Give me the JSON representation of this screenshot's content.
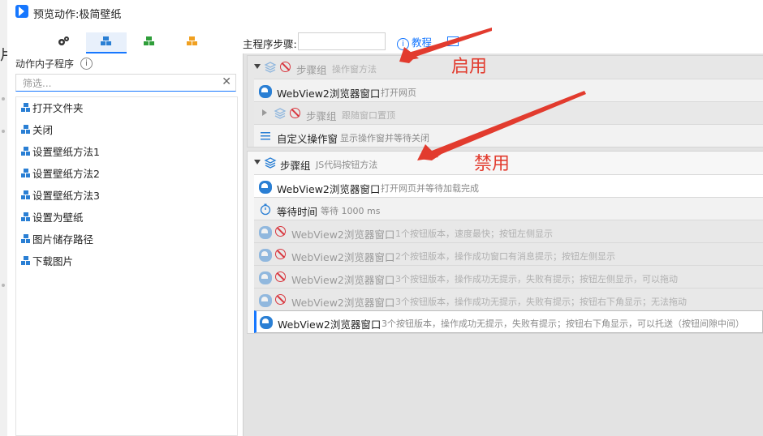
{
  "window": {
    "title": "预览动作:极简壁纸"
  },
  "underlay": {
    "glyph": "片"
  },
  "left_panel": {
    "tabs": [
      {
        "icon": "gears-icon",
        "active": false
      },
      {
        "icon": "blue-stack-icon",
        "active": true
      },
      {
        "icon": "green-stack-icon",
        "active": false
      },
      {
        "icon": "orange-stack-icon",
        "active": false
      }
    ],
    "title": "动作内子程序",
    "info": "i",
    "filter": {
      "placeholder": "筛选...",
      "value": "",
      "clear": "✕"
    },
    "items": [
      {
        "label": "打开文件夹"
      },
      {
        "label": "关闭"
      },
      {
        "label": "设置壁纸方法1"
      },
      {
        "label": "设置壁纸方法2"
      },
      {
        "label": "设置壁纸方法3"
      },
      {
        "label": "设置为壁纸"
      },
      {
        "label": "图片储存路径"
      },
      {
        "label": "下载图片"
      }
    ]
  },
  "right_panel": {
    "main_steps_label": "主程序步骤:",
    "main_steps_value": "",
    "tutorial": "教程",
    "group1": {
      "header": {
        "name": "步骤组",
        "desc": "操作窗方法",
        "enabled": false
      },
      "children": [
        {
          "name": "WebView2浏览器窗口",
          "desc": "打开网页",
          "enabled": true,
          "icon": "edge-icon"
        },
        {
          "name": "步骤组",
          "desc": "跟随窗口置顶",
          "enabled": false,
          "icon": "stack-icon"
        },
        {
          "name": "自定义操作窗",
          "desc": "显示操作窗并等待关闭",
          "enabled": true,
          "icon": "menu-icon"
        }
      ]
    },
    "group2": {
      "header": {
        "name": "步骤组",
        "desc": "JS代码按钮方法",
        "enabled": true
      },
      "children": [
        {
          "name": "WebView2浏览器窗口",
          "desc": "打开网页并等待加载完成",
          "enabled": true,
          "icon": "edge-icon"
        },
        {
          "name": "等待时间",
          "desc": "等待 1000 ms",
          "enabled": true,
          "icon": "timer-icon"
        },
        {
          "name": "WebView2浏览器窗口",
          "desc": "1个按钮版本，速度最快；按钮左侧显示",
          "enabled": false,
          "icon": "edge-icon"
        },
        {
          "name": "WebView2浏览器窗口",
          "desc": "2个按钮版本，操作成功窗口有消息提示；按钮左侧显示",
          "enabled": false,
          "icon": "edge-icon"
        },
        {
          "name": "WebView2浏览器窗口",
          "desc": "3个按钮版本，操作成功无提示，失败有提示；按钮左侧显示，可以拖动",
          "enabled": false,
          "icon": "edge-icon"
        },
        {
          "name": "WebView2浏览器窗口",
          "desc": "3个按钮版本，操作成功无提示，失败有提示；按钮右下角显示；无法拖动",
          "enabled": false,
          "icon": "edge-icon"
        },
        {
          "name": "WebView2浏览器窗口",
          "desc": "3个按钮版本，操作成功无提示，失败有提示；按钮右下角显示，可以托送（按钮间隙中间）",
          "enabled": true,
          "icon": "edge-icon",
          "selected": true
        }
      ]
    }
  },
  "annotations": {
    "enabled_label": "启用",
    "disabled_label": "禁用",
    "arrow_color": "#e23b2e"
  },
  "colors": {
    "accent": "#1677ff",
    "disabled_red": "#d9363e"
  }
}
